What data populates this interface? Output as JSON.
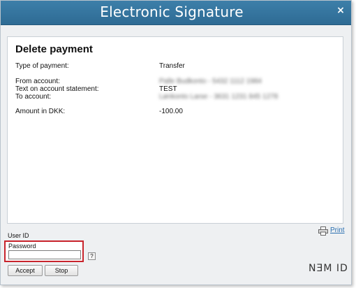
{
  "window": {
    "title": "Electronic Signature",
    "close_symbol": "×"
  },
  "payment": {
    "heading": "Delete payment",
    "rows": [
      {
        "label": "Type of payment:",
        "value": "Transfer"
      },
      {
        "label": "From account:",
        "value": "Palle Budkonto - 5432 1112 1984",
        "redacted": true
      },
      {
        "label": "Text on account statement:",
        "value": "TEST"
      },
      {
        "label": "To account:",
        "value": "Lønkonto Larse - 3631 1231 845 1278",
        "redacted": true
      },
      {
        "label": "Amount in DKK:",
        "value": "-100.00"
      }
    ]
  },
  "print": {
    "label": "Print",
    "icon": "printer-icon"
  },
  "login": {
    "user_id_label": "User ID",
    "password_label": "Password",
    "password_value": "",
    "help_label": "?"
  },
  "buttons": {
    "accept": "Accept",
    "stop": "Stop"
  },
  "brand": {
    "logo_text": "NƎM ID"
  },
  "colors": {
    "titlebar": "#2e6b94",
    "highlight": "#c8242c",
    "link": "#2a6fb0"
  }
}
